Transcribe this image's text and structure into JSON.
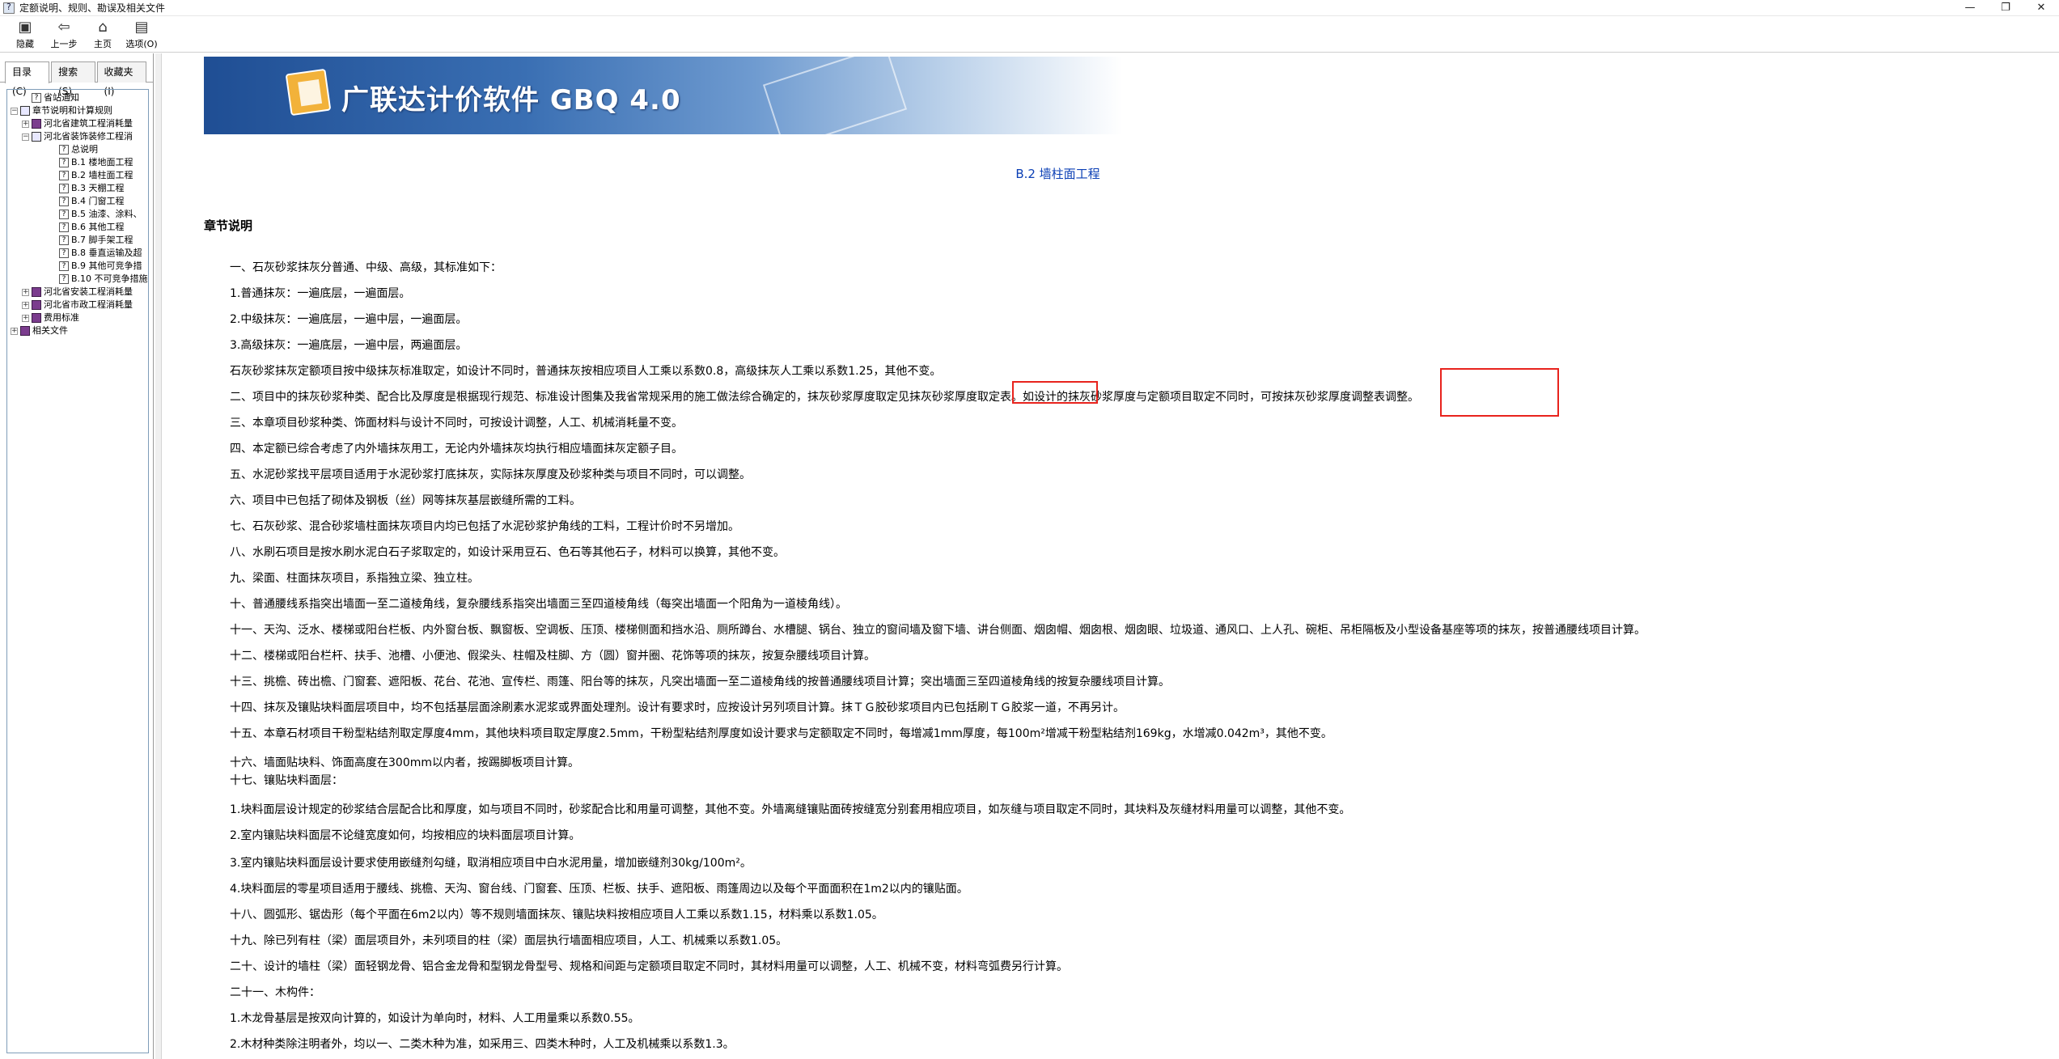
{
  "window": {
    "title": "定额说明、规则、勘误及相关文件",
    "minimize": "—",
    "restore": "❐",
    "close": "✕"
  },
  "toolbar": [
    {
      "label": "隐藏",
      "icon": "hide-icon"
    },
    {
      "label": "上一步",
      "icon": "back-icon"
    },
    {
      "label": "主页",
      "icon": "home-icon"
    },
    {
      "label": "选项(O)",
      "icon": "options-icon"
    }
  ],
  "tabs": [
    "目录(C)",
    "搜索(S)",
    "收藏夹(I)"
  ],
  "tree": [
    {
      "label": "省站通知",
      "level": 1,
      "exp": "",
      "icon": "page"
    },
    {
      "label": "章节说明和计算规则",
      "level": 0,
      "exp": "⊟",
      "icon": "openbook"
    },
    {
      "label": "河北省建筑工程消耗量",
      "level": 1,
      "exp": "⊞",
      "icon": "book"
    },
    {
      "label": "河北省装饰装修工程消",
      "level": 1,
      "exp": "⊟",
      "icon": "openbook"
    },
    {
      "label": "总说明",
      "level": 3,
      "exp": "",
      "icon": "page"
    },
    {
      "label": "B.1 楼地面工程",
      "level": 3,
      "exp": "",
      "icon": "page"
    },
    {
      "label": "B.2 墙柱面工程",
      "level": 3,
      "exp": "",
      "icon": "page"
    },
    {
      "label": "B.3 天棚工程",
      "level": 3,
      "exp": "",
      "icon": "page"
    },
    {
      "label": "B.4 门窗工程",
      "level": 3,
      "exp": "",
      "icon": "page"
    },
    {
      "label": "B.5 油漆、涂料、",
      "level": 3,
      "exp": "",
      "icon": "page"
    },
    {
      "label": "B.6 其他工程",
      "level": 3,
      "exp": "",
      "icon": "page"
    },
    {
      "label": "B.7 脚手架工程",
      "level": 3,
      "exp": "",
      "icon": "page"
    },
    {
      "label": "B.8 垂直运输及超",
      "level": 3,
      "exp": "",
      "icon": "page"
    },
    {
      "label": "B.9 其他可竞争措",
      "level": 3,
      "exp": "",
      "icon": "page"
    },
    {
      "label": "B.10 不可竞争措施",
      "level": 3,
      "exp": "",
      "icon": "page"
    },
    {
      "label": "河北省安装工程消耗量",
      "level": 1,
      "exp": "⊞",
      "icon": "book"
    },
    {
      "label": "河北省市政工程消耗量",
      "level": 1,
      "exp": "⊞",
      "icon": "book"
    },
    {
      "label": "费用标准",
      "level": 1,
      "exp": "⊞",
      "icon": "book"
    },
    {
      "label": "相关文件",
      "level": 0,
      "exp": "⊞",
      "icon": "book"
    }
  ],
  "banner": {
    "title": "广联达计价软件 GBQ 4.0"
  },
  "content": {
    "section_title": "B.2 墙柱面工程",
    "chapter_heading": "章节说明",
    "paragraphs": [
      "一、石灰砂浆抹灰分普通、中级、高级，其标准如下：",
      "1.普通抹灰：一遍底层，一遍面层。",
      "2.中级抹灰：一遍底层，一遍中层，一遍面层。",
      "3.高级抹灰：一遍底层，一遍中层，两遍面层。",
      "石灰砂浆抹灰定额项目按中级抹灰标准取定，如设计不同时，普通抹灰按相应项目人工乘以系数0.8，高级抹灰人工乘以系数1.25，其他不变。",
      "二、项目中的抹灰砂浆种类、配合比及厚度是根据现行规范、标准设计图集及我省常规采用的施工做法综合确定的，抹灰砂浆厚度取定见抹灰砂浆厚度取定表。如设计的抹灰砂浆厚度与定额项目取定不同时，可按抹灰砂浆厚度调整表调整。",
      "三、本章项目砂浆种类、饰面材料与设计不同时，可按设计调整，人工、机械消耗量不变。",
      "四、本定额已综合考虑了内外墙抹灰用工，无论内外墙抹灰均执行相应墙面抹灰定额子目。",
      "五、水泥砂浆找平层项目适用于水泥砂浆打底抹灰，实际抹灰厚度及砂浆种类与项目不同时，可以调整。",
      "六、项目中已包括了砌体及钢板（丝）网等抹灰基层嵌缝所需的工料。",
      "七、石灰砂浆、混合砂浆墙柱面抹灰项目内均已包括了水泥砂浆护角线的工料，工程计价时不另增加。",
      "八、水刷石项目是按水刷水泥白石子浆取定的，如设计采用豆石、色石等其他石子，材料可以换算，其他不变。",
      "九、梁面、柱面抹灰项目，系指独立梁、独立柱。",
      "十、普通腰线系指突出墙面一至二道棱角线，复杂腰线系指突出墙面三至四道棱角线（每突出墙面一个阳角为一道棱角线）。",
      "十一、天沟、泛水、楼梯或阳台栏板、内外窗台板、飘窗板、空调板、压顶、楼梯侧面和挡水沿、厕所蹲台、水槽腿、锅台、独立的窗间墙及窗下墙、讲台侧面、烟囱帽、烟囱根、烟囱眼、垃圾道、通风口、上人孔、碗柜、吊柜隔板及小型设备基座等项的抹灰，按普通腰线项目计算。",
      "十二、楼梯或阳台栏杆、扶手、池槽、小便池、假梁头、柱帽及柱脚、方（圆）窗并圈、花饰等项的抹灰，按复杂腰线项目计算。",
      "十三、挑檐、砖出檐、门窗套、遮阳板、花台、花池、宣传栏、雨篷、阳台等的抹灰，凡突出墙面一至二道棱角线的按普通腰线项目计算；突出墙面三至四道棱角线的按复杂腰线项目计算。",
      "十四、抹灰及镶贴块料面层项目中，均不包括基层面涂刷素水泥浆或界面处理剂。设计有要求时，应按设计另列项目计算。抹ＴＧ胶砂浆项目内已包括刷ＴＧ胶浆一道，不再另计。",
      "十五、本章石材项目干粉型粘结剂取定厚度4mm，其他块料项目取定厚度2.5mm，干粉型粘结剂厚度如设计要求与定额取定不同时，每增减1mm厚度，每100m²增减干粉型粘结剂169kg，水增减0.042m³，其他不变。",
      "十六、墙面贴块料、饰面高度在300mm以内者，按踢脚板项目计算。",
      "十七、镶贴块料面层：",
      "1.块料面层设计规定的砂浆结合层配合比和厚度，如与项目不同时，砂浆配合比和用量可调整，其他不变。外墙离缝镶贴面砖按缝宽分别套用相应项目，如灰缝与项目取定不同时，其块料及灰缝材料用量可以调整，其他不变。",
      "2.室内镶贴块料面层不论缝宽度如何，均按相应的块料面层项目计算。",
      "3.室内镶贴块料面层设计要求使用嵌缝剂勾缝，取消相应项目中白水泥用量，增加嵌缝剂30kg/100m²。",
      "4.块料面层的零星项目适用于腰线、挑檐、天沟、窗台线、门窗套、压顶、栏板、扶手、遮阳板、雨篷周边以及每个平面面积在1m2以内的镶贴面。",
      "十八、圆弧形、锯齿形（每个平面在6m2以内）等不规则墙面抹灰、镶贴块料按相应项目人工乘以系数1.15，材料乘以系数1.05。",
      "十九、除已列有柱（梁）面层项目外，未列项目的柱（梁）面层执行墙面相应项目，人工、机械乘以系数1.05。",
      "二十、设计的墙柱（梁）面轻钢龙骨、铝合金龙骨和型钢龙骨型号、规格和间距与定额项目取定不同时，其材料用量可以调整，人工、机械不变，材料弯弧费另行计算。",
      "二十一、木构件：",
      "1.木龙骨基层是按双向计算的，如设计为单向时，材料、人工用量乘以系数0.55。",
      "2.木材种类除注明者外，均以一、二类木种为准，如采用三、四类木种时，人工及机械乘以系数1.3。"
    ]
  },
  "highlights": [
    "抹灰砂浆厚度取定表",
    "抹灰砂浆厚度调整表"
  ]
}
